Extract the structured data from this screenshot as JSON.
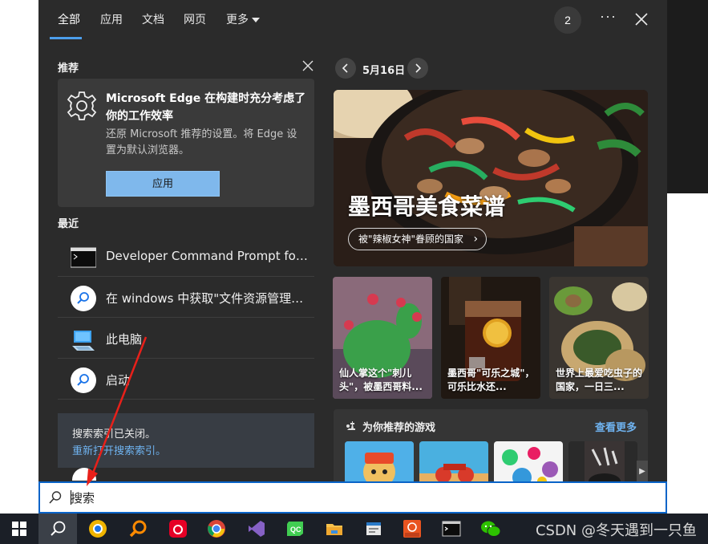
{
  "tabs": [
    {
      "label": "全部",
      "active": true
    },
    {
      "label": "应用"
    },
    {
      "label": "文档"
    },
    {
      "label": "网页"
    },
    {
      "label": "更多"
    }
  ],
  "header": {
    "badge": "2",
    "more": "···"
  },
  "recommend": {
    "section_title": "推荐",
    "title": "Microsoft Edge 在构建时充分考虑了你的工作效率",
    "description": "还原 Microsoft 推荐的设置。将 Edge 设置为默认浏览器。",
    "button": "应用"
  },
  "recent": {
    "section_title": "最近",
    "items": [
      {
        "label": "Developer Command Prompt for ...",
        "icon": "cmd-icon"
      },
      {
        "label": "在 windows 中获取\"文件资源管理器...",
        "icon": "search-icon"
      },
      {
        "label": "此电脑",
        "icon": "computer-icon"
      },
      {
        "label": "启动",
        "icon": "search-icon"
      }
    ]
  },
  "index_notice": {
    "text": "搜索索引已关闭。",
    "link": "重新打开搜索索引。"
  },
  "today": {
    "date": "5月16日",
    "hero_title": "墨西哥美食菜谱",
    "hero_pill": "被\"辣椒女神\"眷顾的国家",
    "cards": [
      {
        "caption": "仙人掌这个\"刺儿头\"，被墨西哥料..."
      },
      {
        "caption": "墨西哥\"可乐之城\"，可乐比水还..."
      },
      {
        "caption": "世界上最爱吃虫子的国家，一日三..."
      }
    ]
  },
  "games": {
    "title": "为你推荐的游戏",
    "more": "查看更多"
  },
  "search": {
    "value": "搜索",
    "placeholder": ""
  },
  "taskbar": {
    "items": [
      "windows-start",
      "search",
      "chrome-canary",
      "search-tool",
      "netease-music",
      "chrome",
      "visual-studio",
      "qt-creator",
      "file-explorer",
      "notepad-app",
      "app-1804",
      "terminal",
      "wechat"
    ]
  },
  "watermark": "CSDN @冬天遇到一只鱼",
  "colors": {
    "panel_bg": "#2b2b2b",
    "accent": "#4c9eeb",
    "link": "#6fb3f0",
    "button": "#7fb8ec"
  }
}
